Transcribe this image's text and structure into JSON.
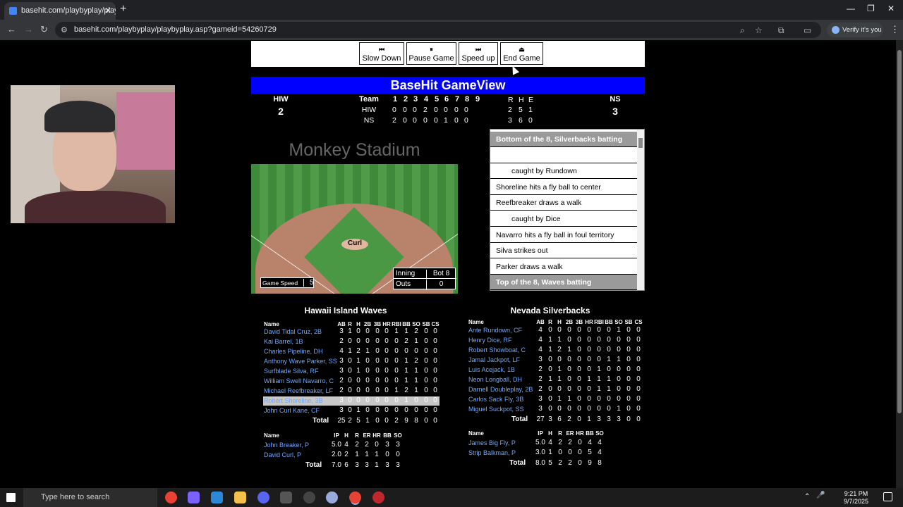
{
  "browser": {
    "tab_title": "basehit.com/playbyplay/playby",
    "url": "basehit.com/playbyplay/playbyplay.asp?gameid=54260729",
    "profile_label": "Verify it's you"
  },
  "controls": {
    "slow_down": "Slow Down",
    "pause": "Pause Game",
    "speed_up": "Speed up",
    "end": "End Game"
  },
  "gameview": {
    "title": "BaseHit GameView",
    "away_abbr": "HIW",
    "home_abbr": "NS",
    "away_runs": "2",
    "home_runs": "3",
    "team_header": "Team",
    "innings": [
      "1",
      "2",
      "3",
      "4",
      "5",
      "6",
      "7",
      "8",
      "9"
    ],
    "rhe": [
      "R",
      "H",
      "E"
    ],
    "linescore": [
      {
        "team": "HIW",
        "innings": [
          "0",
          "0",
          "0",
          "2",
          "0",
          "0",
          "0",
          "0",
          ""
        ],
        "rhe": [
          "2",
          "5",
          "1"
        ]
      },
      {
        "team": "NS",
        "innings": [
          "2",
          "0",
          "0",
          "0",
          "0",
          "1",
          "0",
          "0",
          ""
        ],
        "rhe": [
          "3",
          "6",
          "0"
        ]
      }
    ]
  },
  "field": {
    "stadium": "Monkey Stadium",
    "pitcher": "Curl",
    "speed_label": "Game Speed",
    "speed": "5",
    "inning_label": "Inning",
    "inning": "Bot 8",
    "outs_label": "Outs",
    "outs": "0"
  },
  "pbp": [
    {
      "text": "Bottom of the 8, Silverbacks batting",
      "type": "hdr"
    },
    {
      "text": "",
      "type": "row"
    },
    {
      "text": "caught by Rundown",
      "type": "ind"
    },
    {
      "text": "Shoreline hits a fly ball to center",
      "type": "row"
    },
    {
      "text": "Reefbreaker draws a walk",
      "type": "row"
    },
    {
      "text": "caught by Dice",
      "type": "ind"
    },
    {
      "text": "Navarro hits a fly ball in foul territory",
      "type": "row"
    },
    {
      "text": "Silva strikes out",
      "type": "row"
    },
    {
      "text": "Parker draws a walk",
      "type": "row"
    },
    {
      "text": "Top of the 8, Waves batting",
      "type": "hdr"
    }
  ],
  "batting_headers": [
    "AB",
    "R",
    "H",
    "2B",
    "3B",
    "HR",
    "RBI",
    "BB",
    "SO",
    "SB",
    "CS"
  ],
  "pitching_headers": [
    "IP",
    "H",
    "R",
    "ER",
    "HR",
    "BB",
    "SO"
  ],
  "away": {
    "name": "Hawaii Island Waves",
    "name_header": "Name",
    "batters": [
      {
        "name": "David Tidal Cruz, 2B",
        "stats": [
          "3",
          "1",
          "0",
          "0",
          "0",
          "0",
          "1",
          "1",
          "2",
          "0",
          "0"
        ]
      },
      {
        "name": "Kai Barrel, 1B",
        "stats": [
          "2",
          "0",
          "0",
          "0",
          "0",
          "0",
          "0",
          "2",
          "1",
          "0",
          "0"
        ]
      },
      {
        "name": "Charles Pipeline, DH",
        "stats": [
          "4",
          "1",
          "2",
          "1",
          "0",
          "0",
          "0",
          "0",
          "0",
          "0",
          "0"
        ]
      },
      {
        "name": "Anthony Wave Parker, SS",
        "stats": [
          "3",
          "0",
          "1",
          "0",
          "0",
          "0",
          "0",
          "1",
          "2",
          "0",
          "0"
        ]
      },
      {
        "name": "Surfblade Silva, RF",
        "stats": [
          "3",
          "0",
          "1",
          "0",
          "0",
          "0",
          "0",
          "1",
          "1",
          "0",
          "0"
        ]
      },
      {
        "name": "William Swell Navarro, C",
        "stats": [
          "2",
          "0",
          "0",
          "0",
          "0",
          "0",
          "0",
          "1",
          "1",
          "0",
          "0"
        ]
      },
      {
        "name": "Michael Reefbreaker, LF",
        "stats": [
          "2",
          "0",
          "0",
          "0",
          "0",
          "0",
          "1",
          "2",
          "1",
          "0",
          "0"
        ]
      },
      {
        "name": "Robert Shoreline, 3B",
        "stats": [
          "3",
          "0",
          "0",
          "0",
          "0",
          "0",
          "0",
          "1",
          "0",
          "0",
          "0"
        ],
        "highlight": true
      },
      {
        "name": "John Curl Kane, CF",
        "stats": [
          "3",
          "0",
          "1",
          "0",
          "0",
          "0",
          "0",
          "0",
          "0",
          "0",
          "0"
        ]
      }
    ],
    "total_label": "Total",
    "totals": [
      "25",
      "2",
      "5",
      "1",
      "0",
      "0",
      "2",
      "9",
      "8",
      "0",
      "0"
    ],
    "pitchers": [
      {
        "name": "John Breaker, P",
        "stats": [
          "5.0",
          "4",
          "2",
          "2",
          "0",
          "3",
          "3"
        ]
      },
      {
        "name": "David Curl, P",
        "stats": [
          "2.0",
          "2",
          "1",
          "1",
          "1",
          "0",
          "0"
        ]
      }
    ],
    "pitch_totals": [
      "7.0",
      "6",
      "3",
      "3",
      "1",
      "3",
      "3"
    ]
  },
  "home": {
    "name": "Nevada Silverbacks",
    "name_header": "Name",
    "batters": [
      {
        "name": "Ante Rundown, CF",
        "stats": [
          "4",
          "0",
          "0",
          "0",
          "0",
          "0",
          "0",
          "0",
          "1",
          "0",
          "0"
        ]
      },
      {
        "name": "Henry Dice, RF",
        "stats": [
          "4",
          "1",
          "1",
          "0",
          "0",
          "0",
          "0",
          "0",
          "0",
          "0",
          "0"
        ]
      },
      {
        "name": "Robert Showboat, C",
        "stats": [
          "4",
          "1",
          "2",
          "1",
          "0",
          "0",
          "0",
          "0",
          "0",
          "0",
          "0"
        ]
      },
      {
        "name": "Jamal Jackpot, LF",
        "stats": [
          "3",
          "0",
          "0",
          "0",
          "0",
          "0",
          "0",
          "1",
          "1",
          "0",
          "0"
        ]
      },
      {
        "name": "Luis Acejack, 1B",
        "stats": [
          "2",
          "0",
          "1",
          "0",
          "0",
          "0",
          "1",
          "0",
          "0",
          "0",
          "0"
        ]
      },
      {
        "name": "Neon Longball, DH",
        "stats": [
          "2",
          "1",
          "1",
          "0",
          "0",
          "1",
          "1",
          "1",
          "0",
          "0",
          "0"
        ]
      },
      {
        "name": "Darnell Doubleplay, 2B",
        "stats": [
          "2",
          "0",
          "0",
          "0",
          "0",
          "0",
          "1",
          "1",
          "0",
          "0",
          "0"
        ]
      },
      {
        "name": "Carlos Sack Fly, 3B",
        "stats": [
          "3",
          "0",
          "1",
          "1",
          "0",
          "0",
          "0",
          "0",
          "0",
          "0",
          "0"
        ]
      },
      {
        "name": "Miguel Suckpot, SS",
        "stats": [
          "3",
          "0",
          "0",
          "0",
          "0",
          "0",
          "0",
          "0",
          "1",
          "0",
          "0"
        ]
      }
    ],
    "total_label": "Total",
    "totals": [
      "27",
      "3",
      "6",
      "2",
      "0",
      "1",
      "3",
      "3",
      "3",
      "0",
      "0"
    ],
    "pitchers": [
      {
        "name": "James Big Fly, P",
        "stats": [
          "5.0",
          "4",
          "2",
          "2",
          "0",
          "4",
          "4"
        ]
      },
      {
        "name": "Strip Balkman, P",
        "stats": [
          "3.0",
          "1",
          "0",
          "0",
          "0",
          "5",
          "4"
        ]
      }
    ],
    "pitch_totals": [
      "8.0",
      "5",
      "2",
      "2",
      "0",
      "9",
      "8"
    ]
  },
  "taskbar": {
    "search_placeholder": "Type here to search",
    "time": "9:21 PM",
    "date": "9/7/2025"
  }
}
